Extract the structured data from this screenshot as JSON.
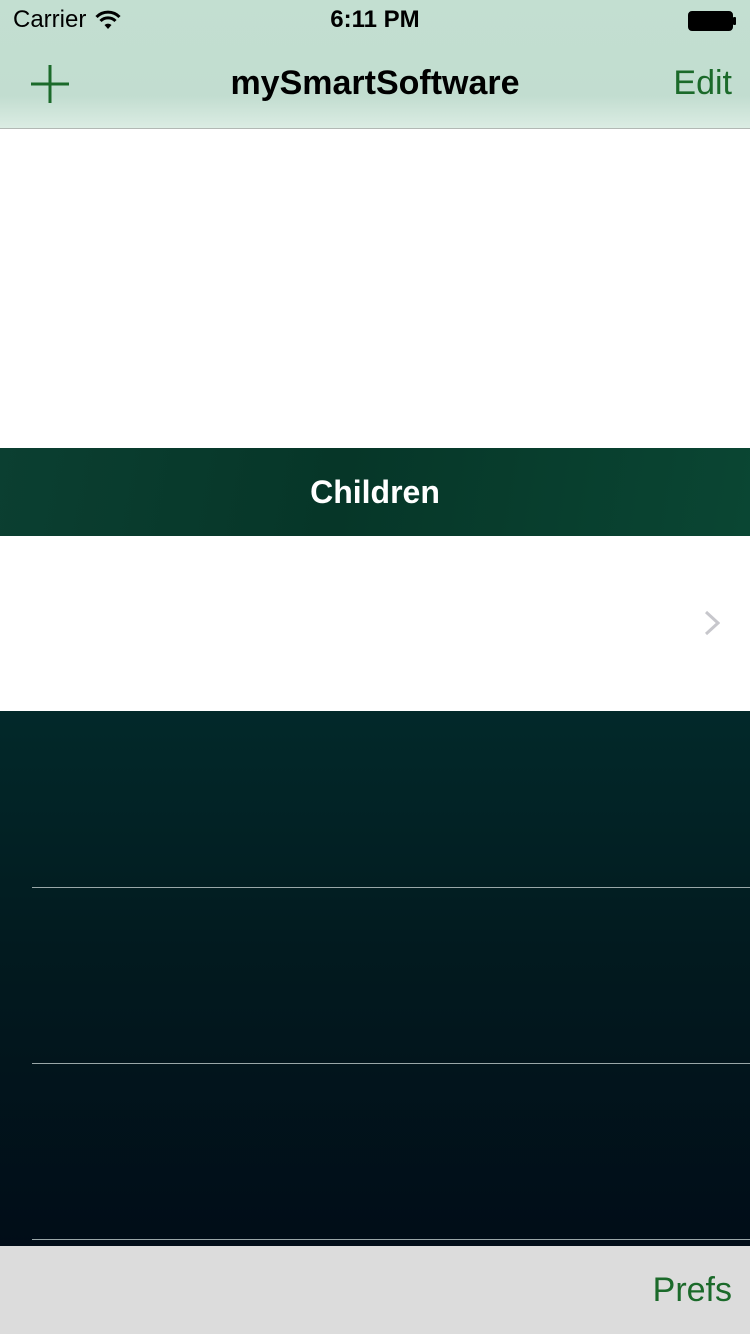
{
  "status_bar": {
    "carrier": "Carrier",
    "time": "6:11 PM"
  },
  "nav_bar": {
    "title": "mySmartSoftware",
    "add_icon": "plus-icon",
    "edit_label": "Edit"
  },
  "section": {
    "header": "Children"
  },
  "toolbar": {
    "prefs_label": "Prefs"
  },
  "colors": {
    "accent": "#1b6a2a",
    "nav_bg": "#c3dfd1",
    "section_bg": "#063628",
    "dark_bg": "#021a1f",
    "toolbar_bg": "#dcdcdc"
  }
}
